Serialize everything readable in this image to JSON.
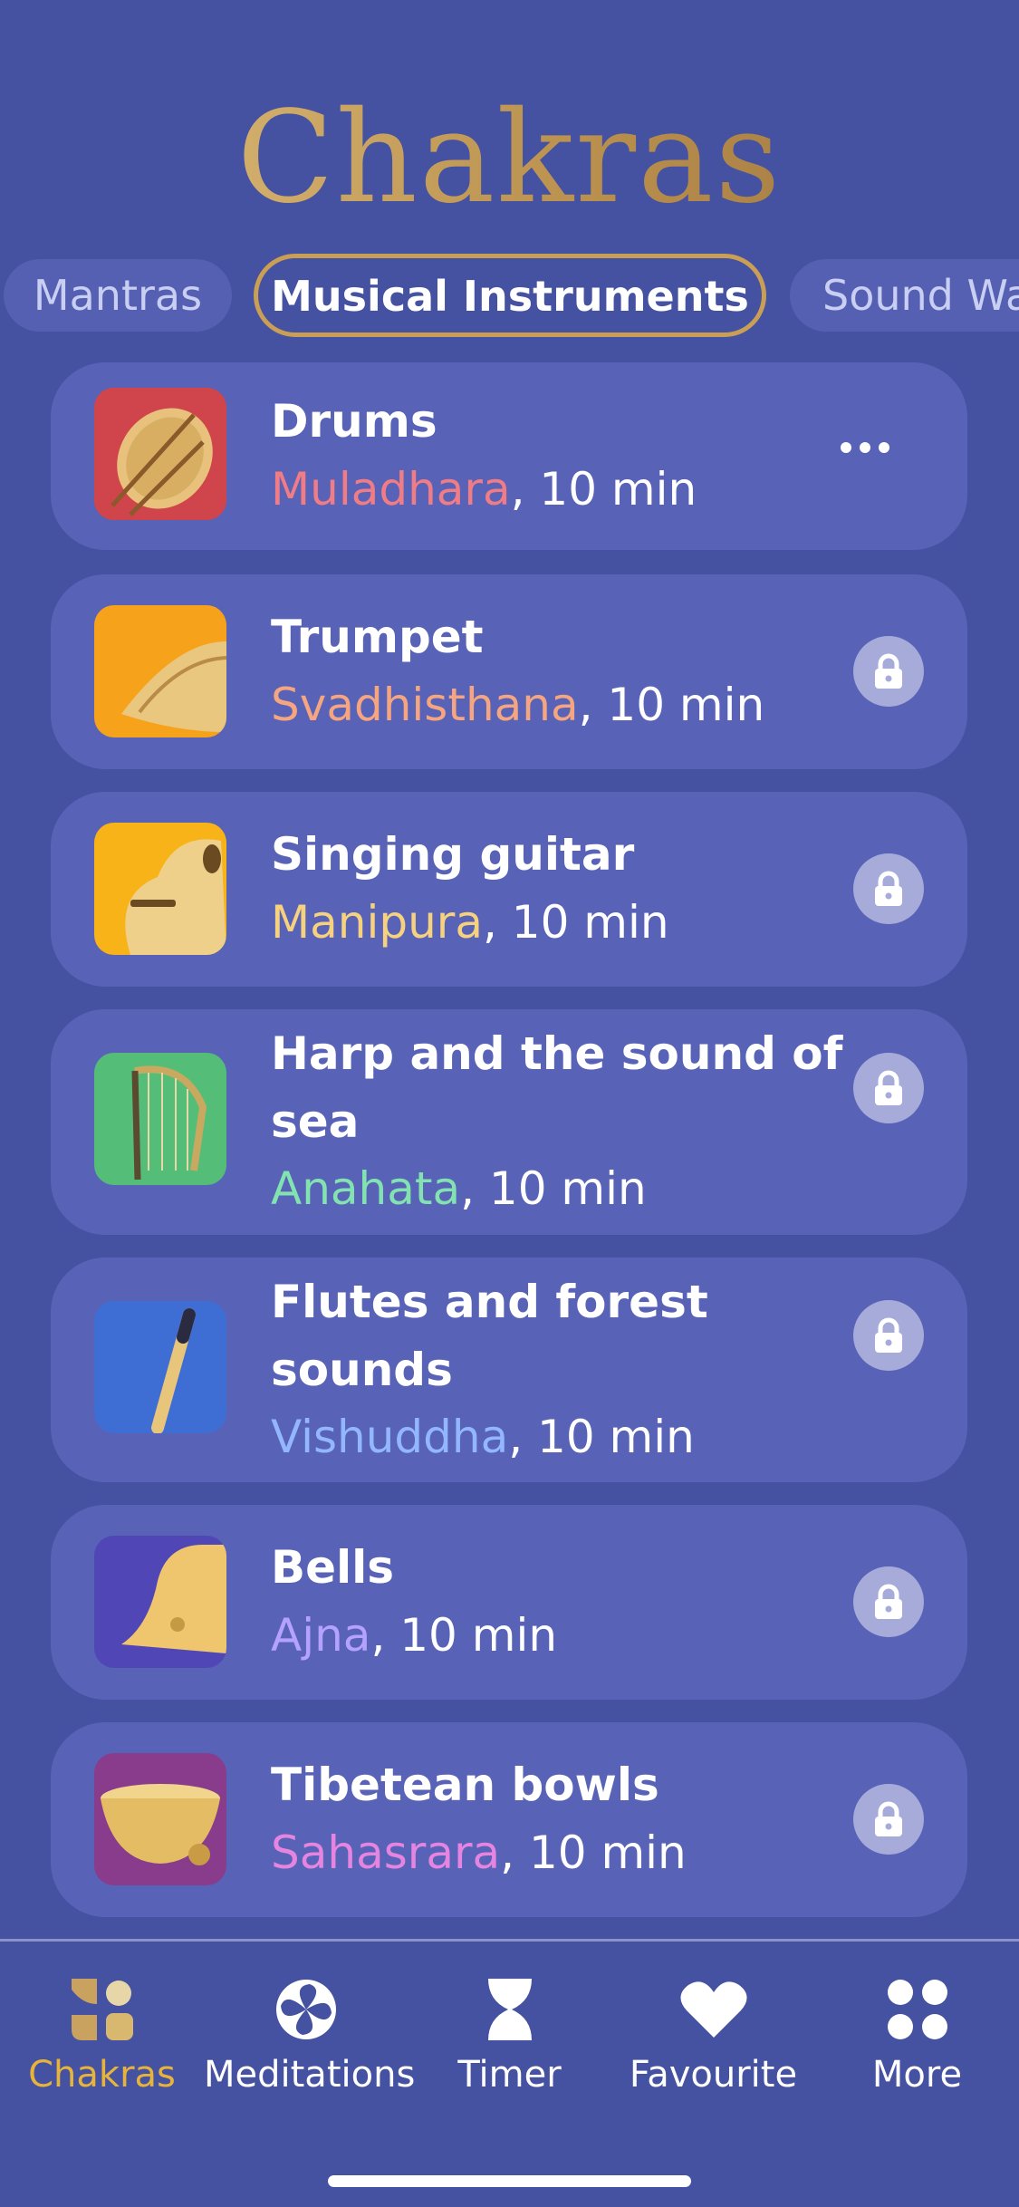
{
  "page_title": "Chakras",
  "tabs": [
    {
      "label": "Mantras",
      "active": false
    },
    {
      "label": "Musical Instruments",
      "active": true
    },
    {
      "label": "Sound Wa",
      "active": false
    }
  ],
  "tracks": [
    {
      "title": "Drums",
      "chakra": "Muladhara",
      "chakra_color": "#F07C86",
      "duration": ", 10 min",
      "action": "more-options-icon",
      "locked": false,
      "thumb_color": "#D2474A"
    },
    {
      "title": "Trumpet",
      "chakra": "Svadhisthana",
      "chakra_color": "#F5A57F",
      "duration": ", 10 min",
      "action": "lock-icon",
      "locked": true,
      "thumb_color": "#F7A21B"
    },
    {
      "title": "Singing guitar",
      "chakra": "Manipura",
      "chakra_color": "#F6D27E",
      "duration": ", 10 min",
      "action": "lock-icon",
      "locked": true,
      "thumb_color": "#F8B318"
    },
    {
      "title": "Harp and the sound of sea",
      "chakra": "Anahata",
      "chakra_color": "#82E3B0",
      "duration": ", 10 min",
      "action": "lock-icon",
      "locked": true,
      "thumb_color": "#54BE78"
    },
    {
      "title": "Flutes and forest sounds",
      "chakra": "Vishuddha",
      "chakra_color": "#93B7FF",
      "duration": ", 10 min",
      "action": "lock-icon",
      "locked": true,
      "thumb_color": "#3E6ED4"
    },
    {
      "title": "Bells",
      "chakra": "Ajna",
      "chakra_color": "#B5A2FF",
      "duration": ", 10 min",
      "action": "lock-icon",
      "locked": true,
      "thumb_color": "#5146B5"
    },
    {
      "title": "Tibetean bowls",
      "chakra": "Sahasrara",
      "chakra_color": "#E585E0",
      "duration": ", 10 min",
      "action": "lock-icon",
      "locked": true,
      "thumb_color": "#8A3C8C"
    }
  ],
  "nav": [
    {
      "label": "Chakras",
      "icon": "chakras-icon",
      "active": true
    },
    {
      "label": "Meditations",
      "icon": "meditations-icon",
      "active": false
    },
    {
      "label": "Timer",
      "icon": "hourglass-icon",
      "active": false
    },
    {
      "label": "Favourite",
      "icon": "heart-icon",
      "active": false
    },
    {
      "label": "More",
      "icon": "grid-dots-icon",
      "active": false
    }
  ],
  "colors": {
    "background": "#4551A1",
    "card": "#5862B7",
    "accent_gold": "#C99E55",
    "nav_active": "#E6B43A"
  }
}
